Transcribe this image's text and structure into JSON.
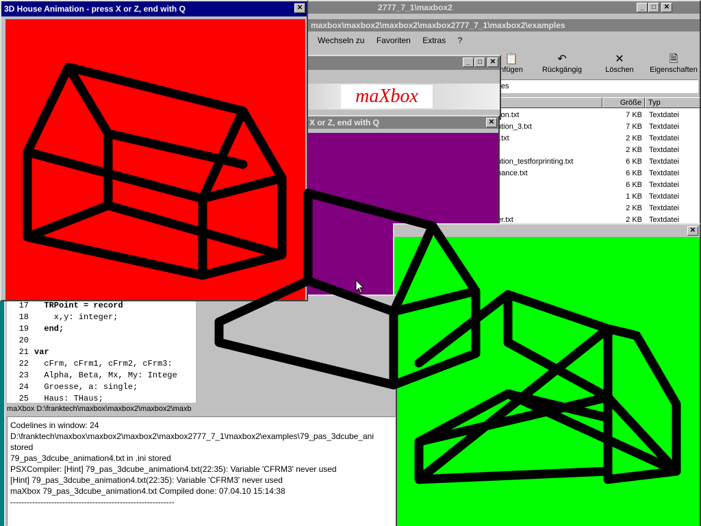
{
  "explorer": {
    "title_back": "2777_7_1\\maxbox2",
    "title": "maxbox\\maxbox2\\maxbox2\\maxbox2777_7_1\\maxbox2\\examples",
    "menu": [
      "Wechseln zu",
      "Favoriten",
      "Extras",
      "?"
    ],
    "toolbar": [
      {
        "label": "nfügen",
        "icon": "paste-icon"
      },
      {
        "label": "Rückgängig",
        "icon": "undo-icon"
      },
      {
        "label": "Löschen",
        "icon": "delete-icon"
      },
      {
        "label": "Eigenschaften",
        "icon": "properties-icon"
      }
    ],
    "address": "iles",
    "columns": {
      "size": "Größe",
      "type": "Typ"
    },
    "files": [
      {
        "name": "tion.txt",
        "size": "7 KB",
        "type": "Textdatei"
      },
      {
        "name": "ution_3.txt",
        "size": "7 KB",
        "type": "Textdatei"
      },
      {
        "name": "t.txt",
        "size": "2 KB",
        "type": "Textdatei"
      },
      {
        "name": "",
        "size": "2 KB",
        "type": "Textdatei"
      },
      {
        "name": "ution_testforprinting.txt",
        "size": "6 KB",
        "type": "Textdatei"
      },
      {
        "name": "nance.txt",
        "size": "6 KB",
        "type": "Textdatei"
      },
      {
        "name": "",
        "size": "6 KB",
        "type": "Textdatei"
      },
      {
        "name": "",
        "size": "1 KB",
        "type": "Textdatei"
      },
      {
        "name": "",
        "size": "2 KB",
        "type": "Textdatei"
      },
      {
        "name": "er.txt",
        "size": "2 KB",
        "type": "Textdatei"
      }
    ]
  },
  "maxbox_window": {
    "logo": "maXbox"
  },
  "purple_window": {
    "title": "X or Z, end with Q",
    "color": "#800080"
  },
  "green_window": {
    "color": "#00ff00"
  },
  "red_window": {
    "title": "3D House Animation  - press X or Z, end with Q",
    "color": "#ff0000"
  },
  "editor": {
    "lines": [
      {
        "num": "17",
        "code": "  TRPoint = record"
      },
      {
        "num": "18",
        "code": "    x,y: integer;"
      },
      {
        "num": "19",
        "code": "  end;"
      },
      {
        "num": "20",
        "code": ""
      },
      {
        "num": "21",
        "code": "var"
      },
      {
        "num": "22",
        "code": "  cFrm, cFrm1, cFrm2, cFrm3:"
      },
      {
        "num": "23",
        "code": "  Alpha, Beta, Mx, My: Intege"
      },
      {
        "num": "24",
        "code": "  Groesse, a: single;"
      },
      {
        "num": "25",
        "code": "  Haus: THaus;"
      }
    ],
    "status": "maXbox D:\\franktech\\maxbox\\maxbox2\\maxbox2\\maxb"
  },
  "output": {
    "lines": [
      "Codelines in window: 24",
      "D:\\franktech\\maxbox\\maxbox2\\maxbox2\\maxbox2777_7_1\\maxbox2\\examples\\79_pas_3dcube_ani",
      "stored",
      "79_pas_3dcube_animation4.txt in .ini stored",
      "PSXCompiler: [Hint] 79_pas_3dcube_animation4.txt(22:35): Variable 'CFRM3' never used",
      "[Hint] 79_pas_3dcube_animation4.txt(22:35): Variable 'CFRM3' never used",
      "maXbox 79_pas_3dcube_animation4.txt Compiled done: 07.04.10 15:14:38",
      "------------------------------------------------------------"
    ]
  }
}
